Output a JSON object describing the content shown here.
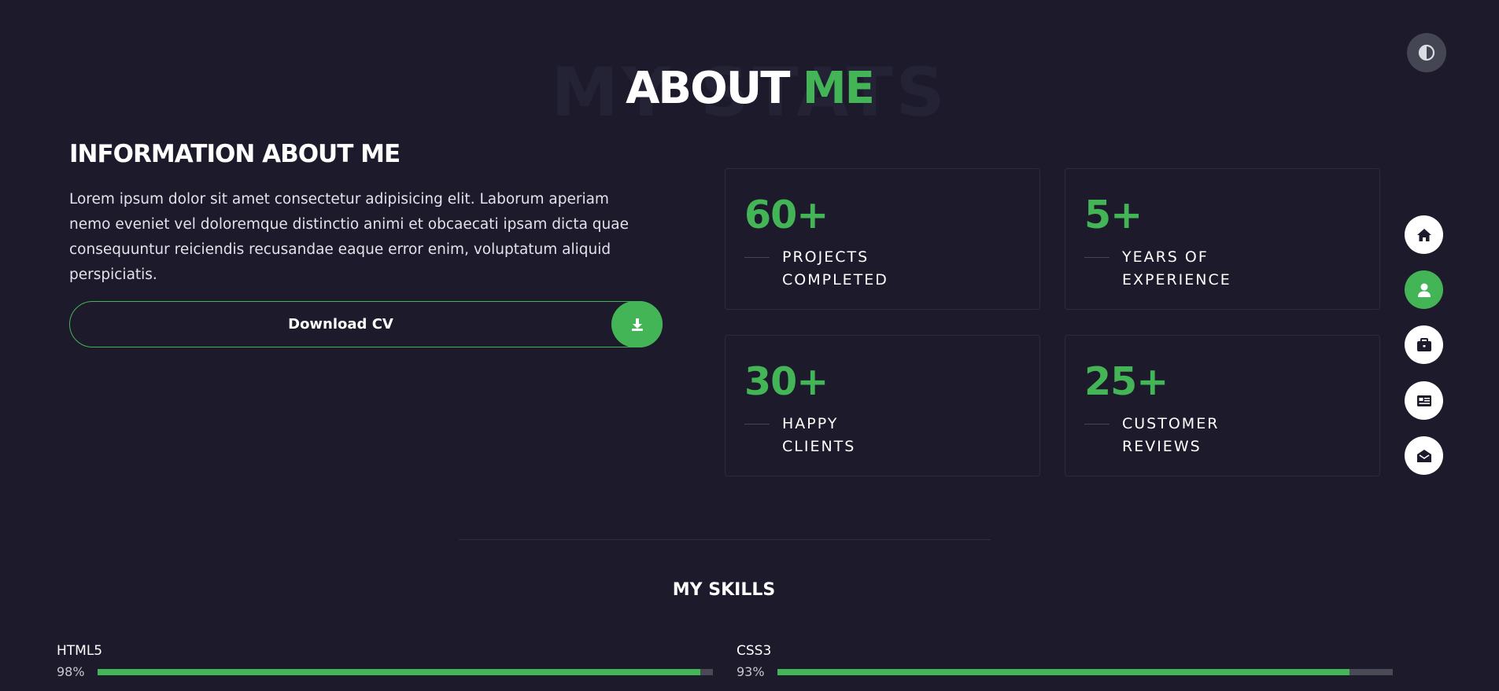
{
  "header": {
    "background_word": "MY STATS",
    "title_main": "ABOUT",
    "title_accent": "ME"
  },
  "info": {
    "title": "INFORMATION ABOUT ME",
    "text": "Lorem ipsum dolor sit amet consectetur adipisicing elit. Laborum aperiam nemo eveniet vel doloremque distinctio animi et obcaecati ipsam dicta quae consequuntur reiciendis recusandae eaque error enim, voluptatum aliquid perspiciatis.",
    "download_label": "Download CV"
  },
  "stats": [
    {
      "number": "60+",
      "line1": "PROJECTS",
      "line2": "COMPLETED"
    },
    {
      "number": "5+",
      "line1": "YEARS OF",
      "line2": "EXPERIENCE"
    },
    {
      "number": "30+",
      "line1": "HAPPY",
      "line2": "CLIENTS"
    },
    {
      "number": "25+",
      "line1": "CUSTOMER",
      "line2": "REVIEWS"
    }
  ],
  "nav": {
    "items": [
      "home-icon",
      "user-icon",
      "briefcase-icon",
      "newspaper-icon",
      "envelope-icon"
    ],
    "active": "user-icon"
  },
  "skills_section": {
    "title": "MY SKILLS",
    "skills": [
      {
        "name": "HTML5",
        "percent_label": "98%",
        "level": 0.98
      },
      {
        "name": "CSS3",
        "percent_label": "93%",
        "level": 0.93
      }
    ]
  },
  "colors": {
    "background": "#1c1a2b",
    "accent": "#44b556"
  }
}
